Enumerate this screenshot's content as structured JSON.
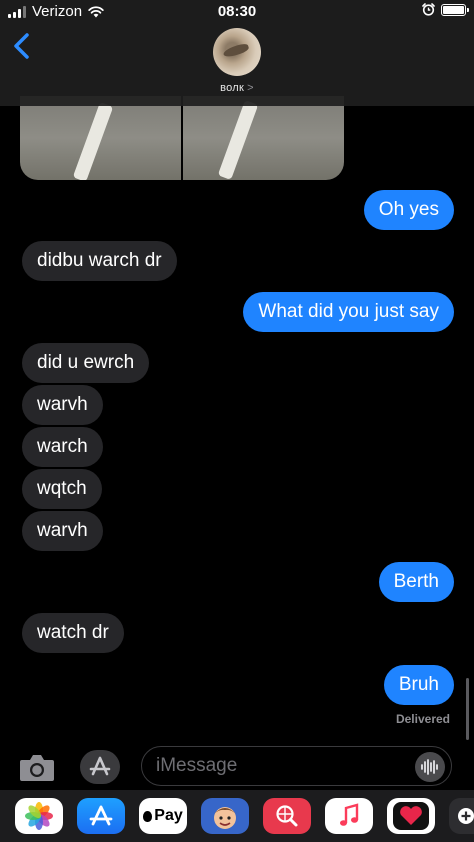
{
  "status_bar": {
    "carrier": "Verizon",
    "time": "08:30",
    "icons": [
      "signal-icon",
      "wifi-icon",
      "alarm-icon",
      "battery-icon"
    ]
  },
  "header": {
    "back_icon": "chevron-left-icon",
    "contact_name": "волк",
    "contact_chevron": ">"
  },
  "conversation": {
    "shared_photo": "photo-attachment",
    "messages": [
      {
        "side": "out",
        "text": "Oh yes"
      },
      {
        "side": "in",
        "text": "didbu warch dr"
      },
      {
        "side": "out",
        "text": "What did you just say"
      },
      {
        "side": "in",
        "text": "did u ewrch"
      },
      {
        "side": "in",
        "text": "warvh"
      },
      {
        "side": "in",
        "text": "warch"
      },
      {
        "side": "in",
        "text": "wqtch"
      },
      {
        "side": "in",
        "text": "warvh"
      },
      {
        "side": "out",
        "text": "Berth"
      },
      {
        "side": "in",
        "text": "watch dr"
      },
      {
        "side": "out",
        "text": "Bruh"
      }
    ],
    "delivered_label": "Delivered"
  },
  "composer": {
    "camera_icon": "camera-icon",
    "apps_icon": "app-store-icon",
    "input_placeholder": "iMessage",
    "input_value": "",
    "audio_icon": "audio-waveform-icon"
  },
  "app_drawer": {
    "apps": [
      "photos",
      "app-store",
      "apple-pay",
      "memoji",
      "web-search",
      "music",
      "digital-touch",
      "more"
    ],
    "apple_pay_label": "Pay"
  },
  "colors": {
    "outgoing_bubble": "#1f84ff",
    "incoming_bubble": "#262629",
    "background": "#000000",
    "header": "#1e1e1e"
  }
}
